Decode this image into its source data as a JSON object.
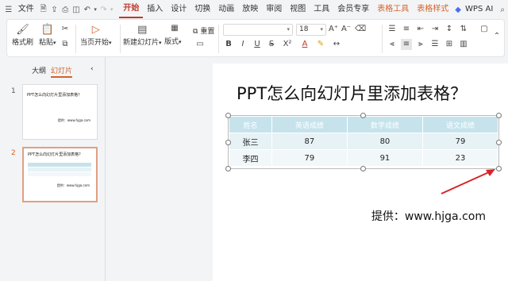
{
  "menubar": {
    "file": "文件",
    "tabs": [
      "开始",
      "插入",
      "设计",
      "切换",
      "动画",
      "放映",
      "审阅",
      "视图",
      "工具",
      "会员专享"
    ],
    "context_tabs": [
      "表格工具",
      "表格样式"
    ],
    "wps_ai": "WPS AI"
  },
  "ribbon": {
    "format_painter": "格式刷",
    "paste": "粘贴",
    "start_from_current": "当页开始",
    "new_slide": "新建幻灯片",
    "layout": "版式",
    "reset": "重置",
    "font_size": "18"
  },
  "left_pane": {
    "tab_outline": "大纲",
    "tab_slides": "幻灯片",
    "slides": [
      {
        "number": "1",
        "title": "PPT怎么向幻灯片里添加表格？",
        "credit": "提供：www.hjga.com"
      },
      {
        "number": "2",
        "title": "PPT怎么向幻灯片里添加表格？",
        "credit": "提供：www.hjga.com"
      }
    ]
  },
  "slide": {
    "title": "PPT怎么向幻灯片里添加表格？",
    "credit": "提供：www.hjga.com",
    "table": {
      "headers": [
        "姓名",
        "英语成绩",
        "数学成绩",
        "语文成绩"
      ],
      "rows": [
        [
          "张三",
          "87",
          "80",
          "79"
        ],
        [
          "李四",
          "79",
          "91",
          "23"
        ]
      ]
    }
  },
  "colors": {
    "accent": "#c0392b",
    "context_tab": "#d4632a",
    "table_header": "#c6e3ec",
    "annotation_arrow": "#d9232a"
  }
}
